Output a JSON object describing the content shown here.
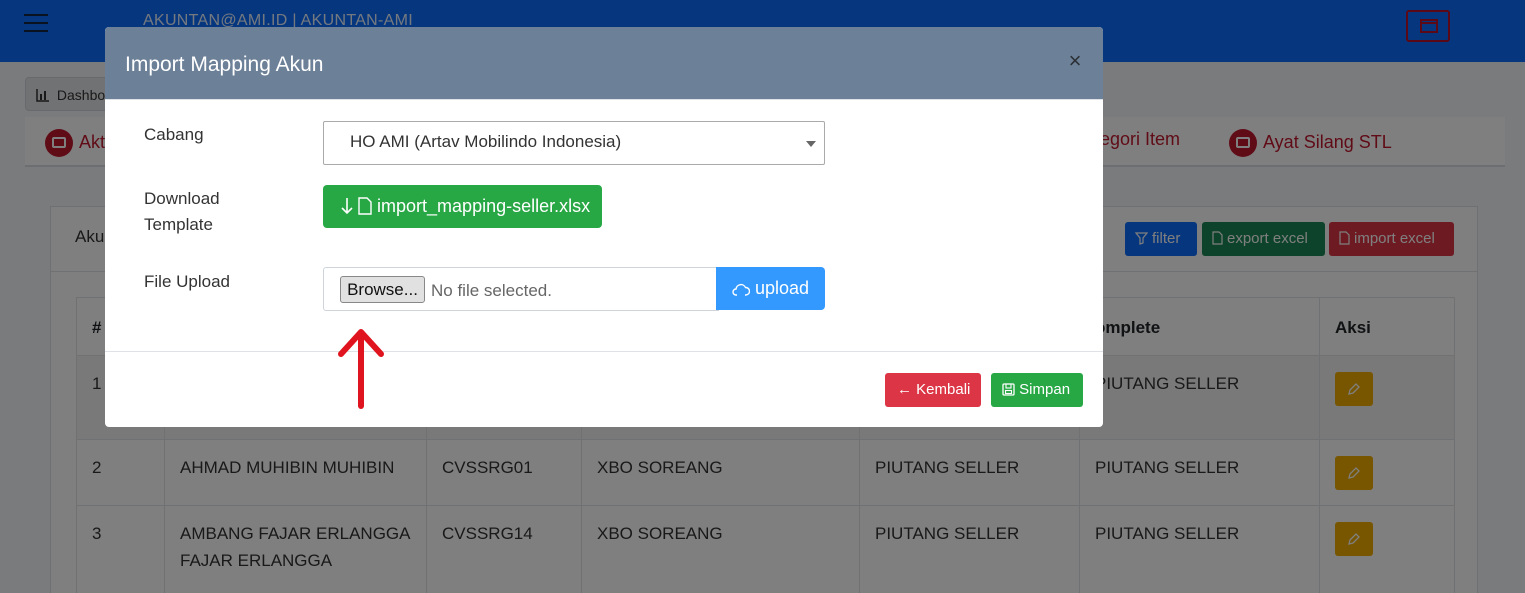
{
  "header": {
    "account": "AKUNTAN@AMI.ID | AKUNTAN-AMI"
  },
  "breadcrumb": {
    "label": "Dashbo"
  },
  "menu": {
    "items": [
      {
        "label": "Akt"
      },
      {
        "label": "tegori Item"
      },
      {
        "label": "Ayat Silang STL"
      }
    ]
  },
  "card": {
    "title": "Aku",
    "filter_label": "filter",
    "export_label": "export excel",
    "import_label": "import excel"
  },
  "table": {
    "headers": [
      "#",
      "omplete",
      "Aksi"
    ],
    "rows": [
      {
        "no": "1",
        "name": "",
        "code": "",
        "branch": "",
        "type": "",
        "complete": "PIUTANG SELLER"
      },
      {
        "no": "2",
        "name": "AHMAD MUHIBIN MUHIBIN",
        "code": "CVSSRG01",
        "branch": "XBO SOREANG",
        "type": "PIUTANG SELLER",
        "complete": "PIUTANG SELLER"
      },
      {
        "no": "3",
        "name": "AMBANG FAJAR ERLANGGA FAJAR ERLANGGA",
        "code": "CVSSRG14",
        "branch": "XBO SOREANG",
        "type": "PIUTANG SELLER",
        "complete": "PIUTANG SELLER"
      }
    ]
  },
  "modal": {
    "title": "Import Mapping Akun",
    "close": "×",
    "cabang_label": "Cabang",
    "cabang_value": "HO AMI (Artav Mobilindo Indonesia)",
    "download_label_1": "Download",
    "download_label_2": "Template",
    "download_file": "import_mapping-seller.xlsx",
    "upload_label": "File Upload",
    "browse_label": "Browse...",
    "no_file_label": "No file selected.",
    "upload_button": "upload",
    "kembali_label": "Kembali",
    "simpan_label": "Simpan"
  },
  "colors": {
    "topbar": "#0d6efd",
    "modal_header": "#6c8098",
    "success": "#28a745",
    "danger": "#dc3545",
    "upload": "#3399ff",
    "annotation_arrow": "#e0141e"
  }
}
